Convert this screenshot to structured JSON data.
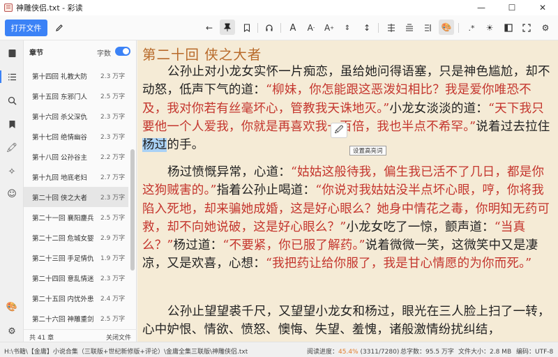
{
  "window": {
    "title": "神雕侠侣.txt - 彩读",
    "minimize": "—",
    "maximize": "☐",
    "close": "✕"
  },
  "toolbar": {
    "open_label": "打开文件",
    "icons": [
      "edit-icon",
      "arrow-left-icon",
      "pin-icon",
      "bookmark-icon",
      "headphones-icon",
      "font-icon",
      "font-decrease-icon",
      "font-increase-icon",
      "line-spacing-icon",
      "paragraph-spacing-icon",
      "align-icon",
      "justify-icon",
      "scroll-mode-icon",
      "palette-icon",
      "regex-icon",
      "brightness-icon",
      "sidebar-icon",
      "fullscreen-icon",
      "settings-icon"
    ]
  },
  "sidebar_icons": [
    "bookshelf-icon",
    "list-icon",
    "search-icon",
    "bookmark-icon",
    "highlight-icon",
    "ai-icon",
    "emoji-icon",
    "theme-icon",
    "settings-icon"
  ],
  "chapters": {
    "header": "章节",
    "word_count_label": "字数",
    "word_count_enabled": true,
    "items": [
      {
        "name": "第十四回 礼教大防",
        "words": "2.3 万字"
      },
      {
        "name": "第十五回 东邪门人",
        "words": "2.5 万字"
      },
      {
        "name": "第十六回 杀父深仇",
        "words": "2.3 万字"
      },
      {
        "name": "第十七回 绝情幽谷",
        "words": "2.3 万字"
      },
      {
        "name": "第十八回 公孙谷主",
        "words": "2.2 万字"
      },
      {
        "name": "第十九回 地底老妇",
        "words": "2.7 万字"
      },
      {
        "name": "第二十回 侠之大者",
        "words": "2.3 万字"
      },
      {
        "name": "第二十一回 襄阳鏖兵",
        "words": "2.5 万字"
      },
      {
        "name": "第二十二回 危城女婴",
        "words": "2.9 万字"
      },
      {
        "name": "第二十三回 手足情仇",
        "words": "1.9 万字"
      },
      {
        "name": "第二十四回 意乱情迷",
        "words": "2.3 万字"
      },
      {
        "name": "第二十五回 内忧外患",
        "words": "2.4 万字"
      },
      {
        "name": "第二十六回 神雕重剑",
        "words": "2.5 万字"
      }
    ],
    "current_index": 6,
    "total": "共 41 章",
    "close_label": "关闭文件"
  },
  "reader": {
    "chapter_title": "第二十回  侠之大者",
    "p1": {
      "a": "公孙止对小龙女实怀一片痴恋，虽给她问得语塞，只是神色尴尬，却不动怒，低声下气的道：",
      "b": "“柳妹，你怎能跟这恶泼妇相比？我是爱你唯恐不及，我对你若有丝毫坏心，管教我天诛地灭。”",
      "c": "小龙女淡淡的道：",
      "d": "“天下我只要他一个人爱我，你就是再喜欢我一百倍，我也半点不希罕。”",
      "e": "说着过去拉住",
      "hl": "杨过",
      "f": "的手。"
    },
    "p2": {
      "a": "杨过愤慨异常，心道：",
      "b": "“姑姑这般待我，偏生我已活不了几日，都是你这狗贼害的。”",
      "c": "指着公孙止喝道：",
      "d": "“你说对我姑姑没半点坏心眼，哼，你将我陷入死地，却来骗她成婚，这是好心眼么？她身中情花之毒，你明知无药可救，却不向她说破，这是好心眼么？”",
      "e": "小龙女吃了一惊，颤声道：",
      "f": "“当真么？”",
      "g": "杨过道：",
      "h": "“不要紧，你已服了解药。”",
      "i": "说着微微一笑，这微笑中又是凄凉，又是欢喜，心想：",
      "j": "“我把药让给你服了，我是甘心情愿的为你而死。”"
    },
    "p3": "公孙止望望裘千尺，又望望小龙女和杨过，眼光在三人脸上扫了一转，心中妒恨、情欲、愤怒、懊悔、失望、羞愧，诸般激情纷扰纠结，",
    "popup_icon": "highlight-pen-icon",
    "tooltip": "设置高亮词"
  },
  "status": {
    "path": "H:\\书籍\\【金庸】小说合集（三联版+世纪新修版+评论）\\金庸全集三联版\\神雕侠侣.txt",
    "progress_label": "阅读进度：",
    "progress_pct": "45.4%",
    "progress_detail": "(3311/7280)",
    "total_words": "总字数：95.5 万字",
    "file_size": "文件大小：2.8 MB",
    "encoding": "编码：UTF-8"
  },
  "colors": {
    "accent": "#3b82f6",
    "reader_bg": "#f5ebd6",
    "dialogue": "#c4352d",
    "chapter_title": "#b86a2a",
    "highlight": "#a9d1f5",
    "progress": "#e07b2c"
  }
}
